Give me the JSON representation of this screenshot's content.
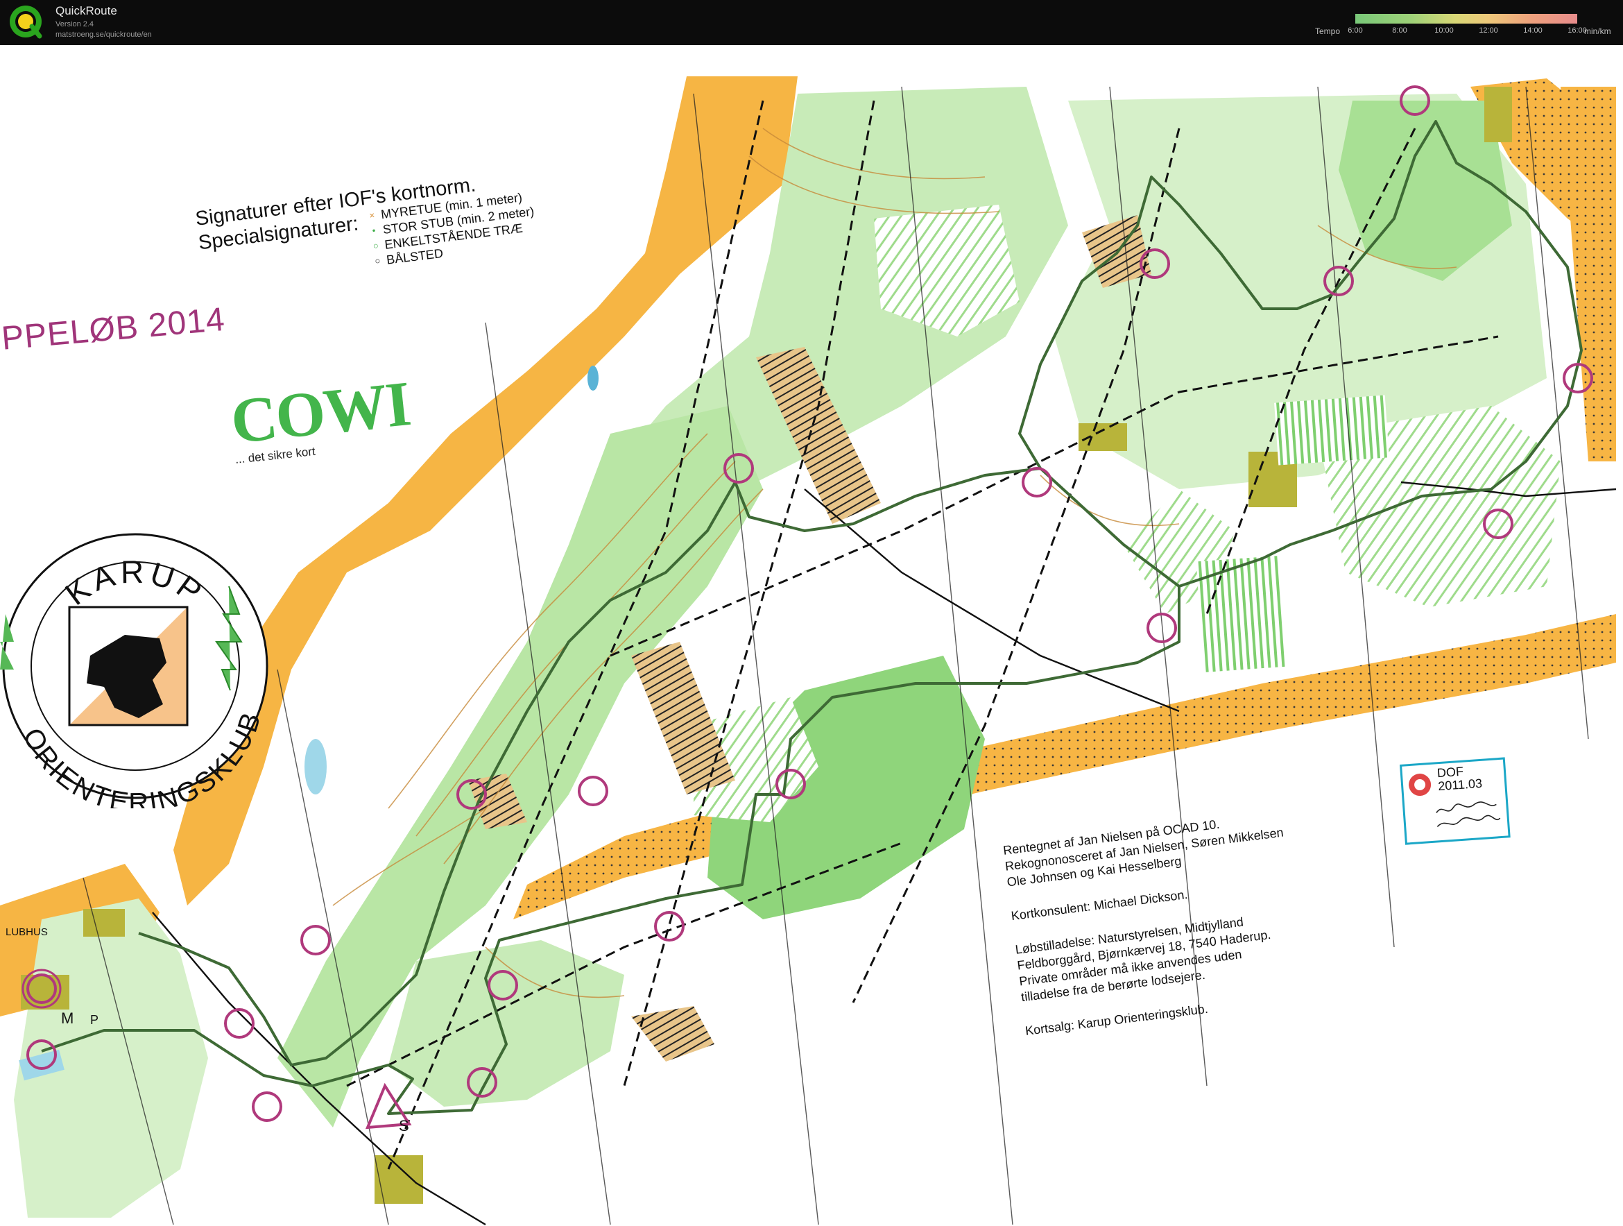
{
  "app": {
    "name": "QuickRoute",
    "version": "Version 2.4",
    "url": "matstroeng.se/quickroute/en"
  },
  "tempo_scale": {
    "label": "Tempo",
    "ticks": [
      "6:00",
      "8:00",
      "10:00",
      "12:00",
      "14:00",
      "16:00"
    ],
    "unit": "min/km",
    "colors": [
      "#79c879",
      "#9ed178",
      "#d8d776",
      "#eec87a",
      "#eea07d",
      "#e78c8c"
    ]
  },
  "map": {
    "legend": {
      "title": "Signaturer efter IOF's kortnorm.",
      "subtitle": "Specialsignaturer:",
      "items": [
        {
          "symbol": "×",
          "label": "MYRETUE (min. 1 meter)"
        },
        {
          "symbol": "•",
          "label": "STOR STUB (min. 2 meter)"
        },
        {
          "symbol": "○",
          "label": "ENKELTSTÅENDE TRÆ"
        },
        {
          "symbol": "○",
          "label": "BÅLSTED"
        }
      ]
    },
    "event_title": "PPELØB 2014",
    "sponsor": {
      "name": "COWI",
      "tagline": "... det sikre kort"
    },
    "club": {
      "top_text": "KARUP",
      "bottom_text": "ORIENTERINGSKLUB"
    },
    "credits": [
      "Rentegnet af Jan Nielsen på OCAD 10.",
      "Rekognonosceret af Jan Nielsen, Søren Mikkelsen",
      "Ole Johnsen og Kai Hesselberg",
      "",
      "Kortkonsulent: Michael Dickson.",
      "",
      "Løbstilladelse: Naturstyrelsen, Midtjylland",
      "Feldborggård, Bjørnkærvej 18, 7540 Haderup.",
      "Private områder må ikke anvendes uden",
      "tilladelse fra de berørte lodsejere.",
      "",
      "Kortsalg: Karup Orienteringsklub."
    ],
    "dof_stamp": {
      "line1": "DOF",
      "line2": "2011.03"
    },
    "place_labels": {
      "lubhus": "LUBHUS",
      "m": "M",
      "p": "P",
      "s": "S"
    },
    "colors": {
      "open_yellow": "#f7b544",
      "light_green": "#c8ebb8",
      "green": "#7fcf6f",
      "course_magenta": "#b0397c",
      "route_green": "#3e6a35"
    }
  }
}
